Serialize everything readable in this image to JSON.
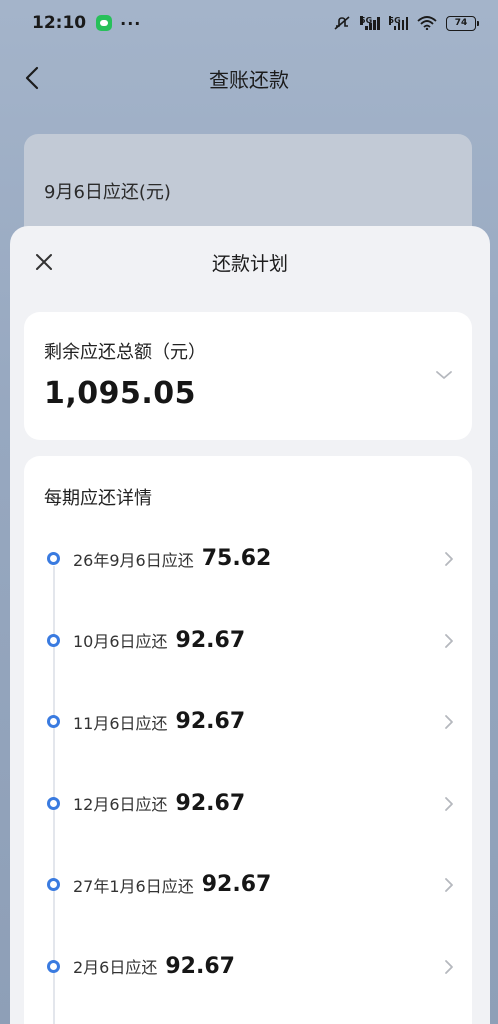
{
  "status_bar": {
    "time": "12:10",
    "dots": "···",
    "network_1": "5G",
    "network_2": "5G",
    "battery": "74"
  },
  "nav": {
    "title": "查账还款"
  },
  "background_card": {
    "label": "9月6日应还(元)"
  },
  "sheet": {
    "title": "还款计划",
    "total": {
      "label": "剩余应还总额（元）",
      "amount": "1,095.05"
    },
    "details": {
      "title": "每期应还详情",
      "installments": [
        {
          "date": "26年9月6日应还",
          "amount": "75.62"
        },
        {
          "date": "10月6日应还",
          "amount": "92.67"
        },
        {
          "date": "11月6日应还",
          "amount": "92.67"
        },
        {
          "date": "12月6日应还",
          "amount": "92.67"
        },
        {
          "date": "27年1月6日应还",
          "amount": "92.67"
        },
        {
          "date": "2月6日应还",
          "amount": "92.67"
        }
      ]
    }
  },
  "colors": {
    "accent": "#3a7be0",
    "sheet_bg": "#f1f2f5",
    "card_bg": "#ffffff",
    "overlay_bg": "#97a8c0"
  },
  "icons": {
    "back": "chevron-left-icon",
    "close": "close-icon",
    "expand": "chevron-down-icon",
    "row_arrow": "chevron-right-icon"
  }
}
